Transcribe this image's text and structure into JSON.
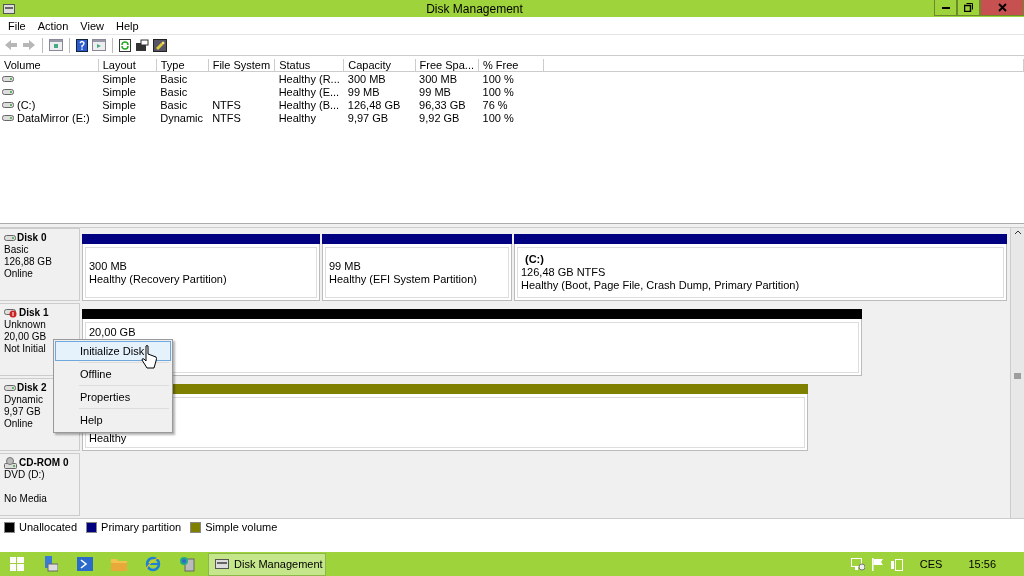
{
  "window": {
    "title": "Disk Management"
  },
  "menu_bar": [
    "File",
    "Action",
    "View",
    "Help"
  ],
  "toolbar": [
    {
      "kind": "back",
      "disabled": true
    },
    {
      "kind": "forward",
      "disabled": true
    },
    {
      "kind": "sep"
    },
    {
      "kind": "pane"
    },
    {
      "kind": "sep"
    },
    {
      "kind": "help"
    },
    {
      "kind": "pane2"
    },
    {
      "kind": "sep"
    },
    {
      "kind": "refresh"
    },
    {
      "kind": "props"
    },
    {
      "kind": "wizard"
    }
  ],
  "volume_table": {
    "columns": [
      "Volume",
      "Layout",
      "Type",
      "File System",
      "Status",
      "Capacity",
      "Free Spa...",
      "% Free"
    ],
    "rows": [
      {
        "cells": [
          "",
          "Simple",
          "Basic",
          "",
          "Healthy (R...",
          "300 MB",
          "300 MB",
          "100 %"
        ]
      },
      {
        "cells": [
          "",
          "Simple",
          "Basic",
          "",
          "Healthy (E...",
          "99 MB",
          "99 MB",
          "100 %"
        ]
      },
      {
        "cells": [
          "(C:)",
          "Simple",
          "Basic",
          "NTFS",
          "Healthy (B...",
          "126,48 GB",
          "96,33 GB",
          "76 %"
        ]
      },
      {
        "cells": [
          "DataMirror (E:)",
          "Simple",
          "Dynamic",
          "NTFS",
          "Healthy",
          "9,97 GB",
          "9,92 GB",
          "100 %"
        ]
      }
    ]
  },
  "disks": [
    {
      "kind": "disk",
      "name": "Disk 0",
      "lines": [
        "Basic",
        "126,88 GB",
        "Online"
      ],
      "partitions": [
        {
          "color": "#000080",
          "lines": [
            "300 MB",
            "Healthy (Recovery Partition)"
          ]
        },
        {
          "color": "#000080",
          "lines": [
            "99 MB",
            "Healthy (EFI System Partition)"
          ]
        },
        {
          "color": "#000080",
          "title": "(C:)",
          "lines": [
            "126,48 GB NTFS",
            "Healthy (Boot, Page File, Crash Dump, Primary Partition)"
          ]
        }
      ]
    },
    {
      "kind": "disk-error",
      "name": "Disk 1",
      "lines": [
        "Unknown",
        "20,00 GB",
        "Not Initial"
      ],
      "partitions": [
        {
          "color": "#000000",
          "lines": [
            "20,00 GB"
          ]
        }
      ]
    },
    {
      "kind": "disk",
      "name": "Disk 2",
      "lines": [
        "Dynamic",
        "9,97 GB",
        "Online"
      ],
      "partitions": [
        {
          "color": "#808000",
          "lines": [
            "Healthy"
          ]
        }
      ]
    },
    {
      "kind": "cdrom",
      "name": "CD-ROM 0",
      "lines": [
        "DVD (D:)",
        "No Media"
      ]
    }
  ],
  "legend": [
    {
      "label": "Unallocated",
      "color": "#000000"
    },
    {
      "label": "Primary partition",
      "color": "#000080"
    },
    {
      "label": "Simple volume",
      "color": "#808000"
    }
  ],
  "context_menu": [
    {
      "label": "Initialize Disk",
      "selected": true
    },
    {
      "label": "Offline",
      "selected": false
    },
    {
      "label": "Properties",
      "selected": false
    },
    {
      "label": "Help",
      "selected": false
    }
  ],
  "taskbar": {
    "active_app": "Disk Management",
    "language": "CES",
    "clock": "15:56"
  }
}
